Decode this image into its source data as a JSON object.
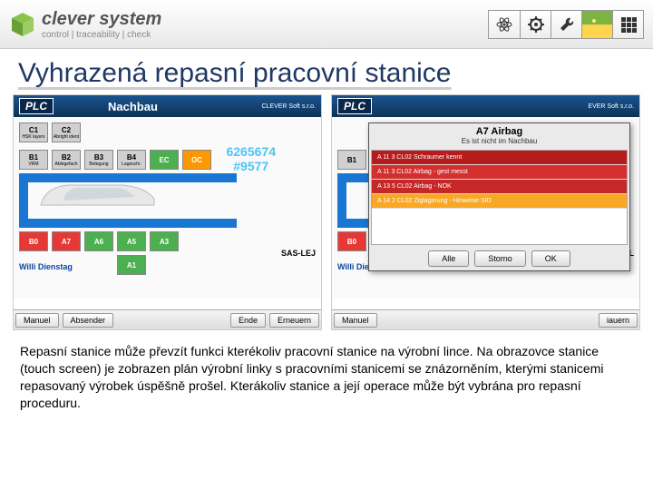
{
  "header": {
    "brand_main": "clever system",
    "brand_sub": "control  |  traceability  |  check"
  },
  "page_title": "Vyhrazená repasní pracovní stanice",
  "panel_left": {
    "plc": "PLC",
    "title": "Nachbau",
    "code_line1": "6265674",
    "code_line2": "#9577",
    "row_c": [
      {
        "id": "C1",
        "sub": "HSK layers"
      },
      {
        "id": "C2",
        "sub": "Abright ident"
      }
    ],
    "row_b": [
      {
        "id": "B1",
        "sub": "VRM"
      },
      {
        "id": "B2",
        "sub": "Ablegefach"
      },
      {
        "id": "B3",
        "sub": "Belegung"
      },
      {
        "id": "B4",
        "sub": "Lageschr."
      },
      {
        "id": "EC",
        "sub": ""
      },
      {
        "id": "OC",
        "sub": ""
      }
    ],
    "row_b2": [
      {
        "id": "B0",
        "sub": ""
      },
      {
        "id": "A7",
        "sub": ""
      },
      {
        "id": "A6",
        "sub": ""
      },
      {
        "id": "A5",
        "sub": ""
      },
      {
        "id": "A3",
        "sub": ""
      }
    ],
    "row_a": [
      {
        "id": "A1",
        "sub": ""
      }
    ],
    "sas": "SAS-LEJ",
    "user": "Willi Dienstag",
    "buttons": {
      "manuel": "Manuel",
      "absender": "Absender",
      "ende": "Ende",
      "erneuern": "Erneuern"
    }
  },
  "panel_right": {
    "plc": "PLC",
    "title": "",
    "row_b": [
      {
        "id": "B1",
        "sub": ""
      }
    ],
    "row_b2": [
      {
        "id": "B0",
        "sub": ""
      }
    ],
    "sas": "SAS-L",
    "user": "Willi Diens",
    "buttons": {
      "manuel": "Manuel",
      "erneuern": "iauern"
    }
  },
  "modal": {
    "title": "A7 Airbag",
    "subtitle": "Es ist nicht im Nachbau",
    "rows": [
      "A 11 3 CL02 Schraumer kennt",
      "A 11 3 CL02 Airbag - gest messt",
      "A 13 5 CL02 Airbag - NOK",
      "A 14 2 CL02 Ziglagerung - Hinweise SID"
    ],
    "btn_alle": "Alle",
    "btn_storno": "Storno",
    "btn_ok": "OK"
  },
  "description": "Repasní stanice může převzít funkci kterékoliv pracovní stanice na výrobní lince. Na obrazovce stanice (touch screen) je zobrazen plán výrobní linky s pracovními stanicemi se znázorněním, kterými stanicemi repasovaný výrobek úspěšně prošel. Kterákoliv stanice a její operace může být vybrána pro repasní proceduru."
}
